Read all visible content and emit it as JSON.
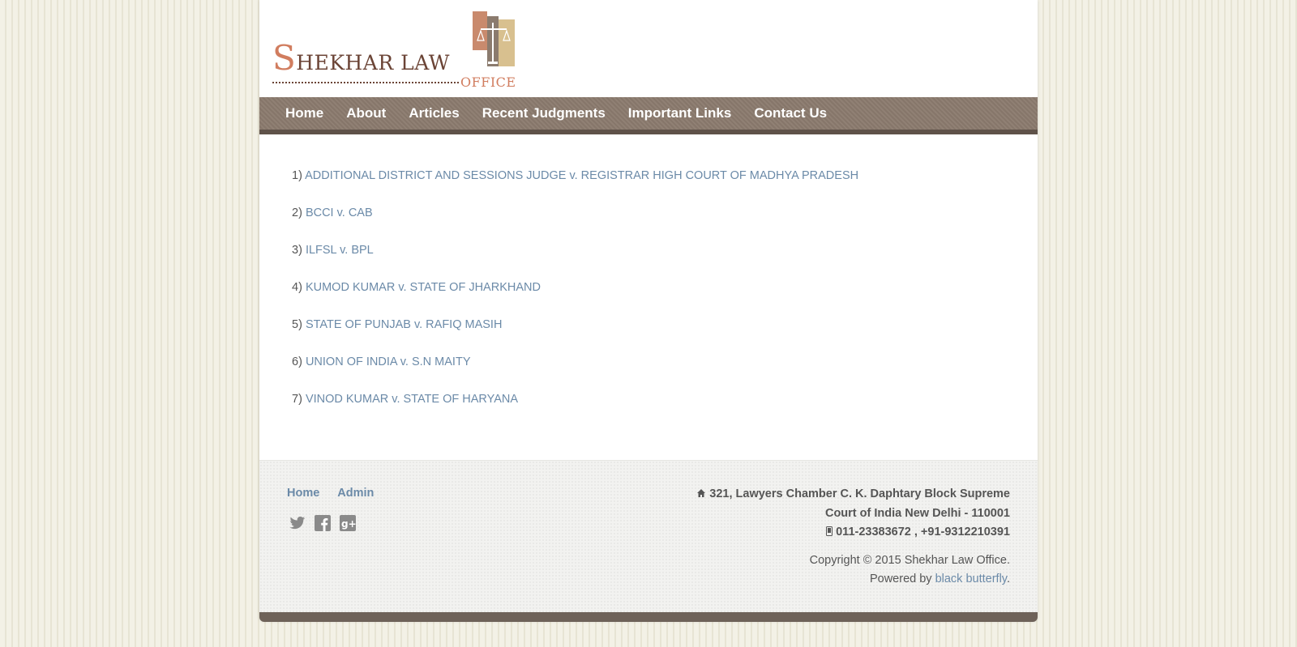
{
  "brand": {
    "logo_line1": "HEKHAR LAW",
    "logo_initial": "S",
    "logo_line2": "OFFICE"
  },
  "nav": {
    "items": [
      {
        "label": "Home"
      },
      {
        "label": "About"
      },
      {
        "label": "Articles"
      },
      {
        "label": "Recent Judgments"
      },
      {
        "label": "Important Links"
      },
      {
        "label": "Contact Us"
      }
    ]
  },
  "judgments": [
    {
      "num": "1)",
      "title": "ADDITIONAL DISTRICT AND SESSIONS JUDGE v. REGISTRAR HIGH COURT OF MADHYA PRADESH"
    },
    {
      "num": "2)",
      "title": "BCCI v. CAB"
    },
    {
      "num": "3)",
      "title": "ILFSL v. BPL"
    },
    {
      "num": "4)",
      "title": "KUMOD KUMAR v. STATE OF JHARKHAND"
    },
    {
      "num": "5)",
      "title": "STATE OF PUNJAB v. RAFIQ MASIH"
    },
    {
      "num": "6)",
      "title": "UNION OF INDIA v. S.N MAITY"
    },
    {
      "num": "7)",
      "title": "VINOD KUMAR v. STATE OF HARYANA"
    }
  ],
  "footer": {
    "links": [
      {
        "label": "Home"
      },
      {
        "label": "Admin"
      }
    ],
    "social_icons": [
      "twitter-icon",
      "facebook-icon",
      "google-plus-icon"
    ],
    "address_line1": "321, Lawyers Chamber C. K. Daphtary Block Supreme",
    "address_line2": "Court of India New Delhi - 110001",
    "phone": "011-23383672 , +91-9312210391",
    "copyright": "Copyright © 2015 Shekhar Law Office.",
    "powered_prefix": "Powered by",
    "powered_link": "black butterfly",
    "powered_suffix": "."
  },
  "colors": {
    "nav_bg": "#8b7b6e",
    "link": "#6b8aa8",
    "logo_accent": "#d17d5f"
  }
}
